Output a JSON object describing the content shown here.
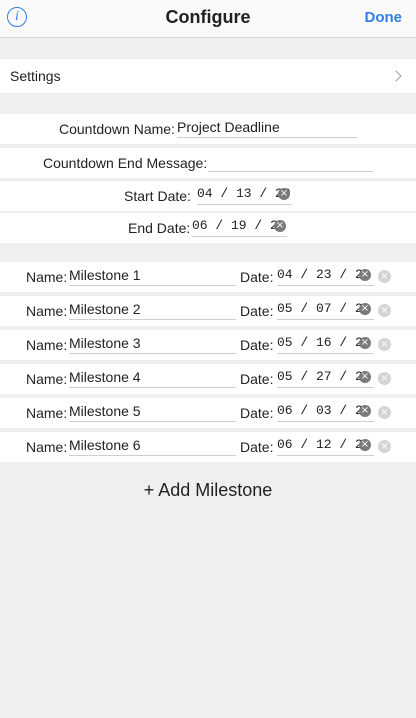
{
  "header": {
    "title": "Configure",
    "done_label": "Done",
    "info_icon": "info-icon"
  },
  "settings": {
    "label": "Settings"
  },
  "countdown": {
    "name_label": "Countdown Name:",
    "name_value": "Project Deadline",
    "end_message_label": "Countdown End Message:",
    "end_message_value": "",
    "start_label": "Start Date:",
    "start_value": "04 / 13 / 20",
    "end_label": "End Date:",
    "end_value": "06 / 19 / 20"
  },
  "milestone_labels": {
    "name": "Name:",
    "date": "Date:"
  },
  "milestones": [
    {
      "name": "Milestone 1",
      "date": "04 / 23 / 20"
    },
    {
      "name": "Milestone 2",
      "date": "05 / 07 / 20"
    },
    {
      "name": "Milestone 3",
      "date": "05 / 16 / 20"
    },
    {
      "name": "Milestone 4",
      "date": "05 / 27 / 20"
    },
    {
      "name": "Milestone 5",
      "date": "06 / 03 / 20"
    },
    {
      "name": "Milestone 6",
      "date": "06 / 12 / 20"
    }
  ],
  "add_milestone_label": "+ Add Milestone",
  "colors": {
    "accent": "#2f7fe6",
    "background": "#efefef"
  }
}
